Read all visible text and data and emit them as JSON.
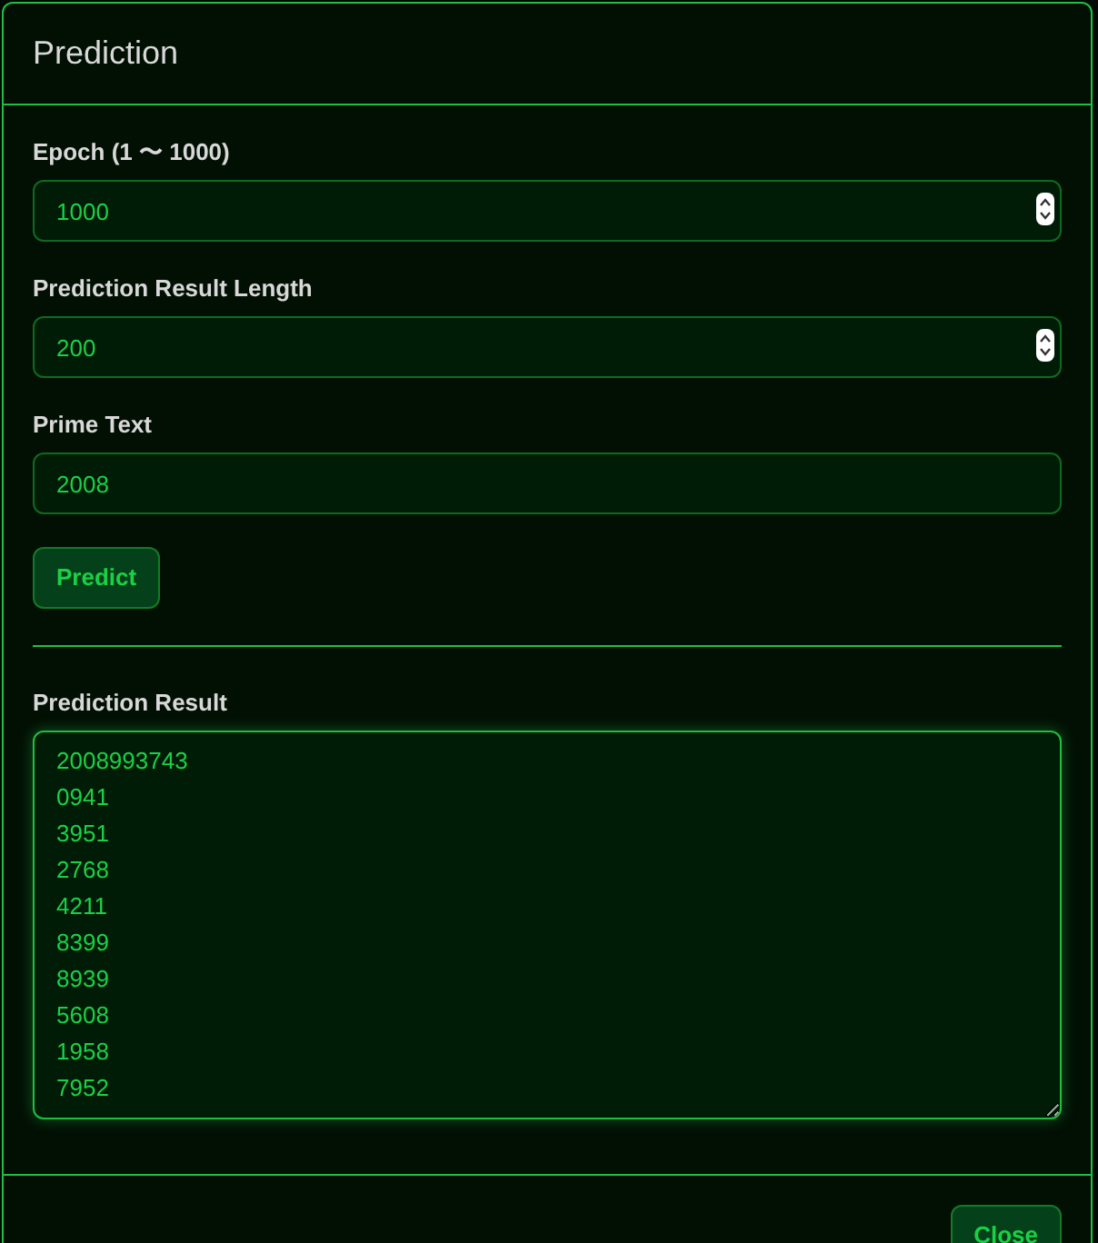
{
  "dialog": {
    "title": "Prediction"
  },
  "fields": [
    {
      "kind": "number",
      "label": "Epoch (1 〜 1000)",
      "value": "1000"
    },
    {
      "kind": "number",
      "label": "Prediction Result Length",
      "value": "200"
    },
    {
      "kind": "text",
      "label": "Prime Text",
      "value": "2008"
    }
  ],
  "predict_button": "Predict",
  "result": {
    "label": "Prediction Result",
    "lines": [
      "2008993743",
      "0941",
      "3951",
      "2768",
      "4211",
      "8399",
      "8939",
      "5608",
      "1958",
      "7952"
    ]
  },
  "footer_buttons": [
    "Close"
  ]
}
